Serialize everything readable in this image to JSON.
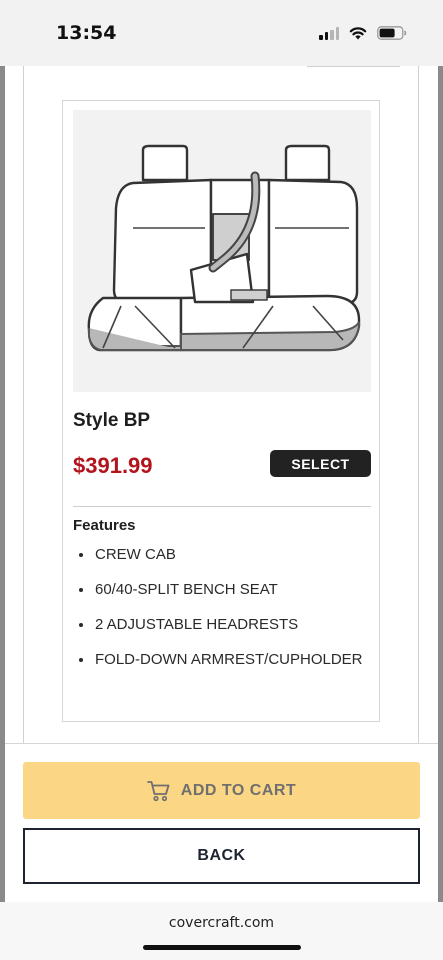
{
  "status_bar": {
    "time": "13:54",
    "icons": [
      "signal-icon",
      "wifi-icon",
      "battery-icon"
    ]
  },
  "product": {
    "style_name": "Style BP",
    "price": "$391.99",
    "select_label": "SELECT",
    "features_title": "Features",
    "features": [
      "CREW CAB",
      "60/40-SPLIT BENCH SEAT",
      "2 ADJUSTABLE HEADRESTS",
      "FOLD-DOWN ARMREST/CUPHOLDER"
    ]
  },
  "actions": {
    "add_to_cart_label": "ADD TO CART",
    "back_label": "BACK"
  },
  "browser": {
    "url": "covercraft.com"
  },
  "colors": {
    "price": "#b3141c",
    "add_to_cart_bg": "#fad685",
    "select_bg": "#222222",
    "back_border": "#1d2430"
  }
}
